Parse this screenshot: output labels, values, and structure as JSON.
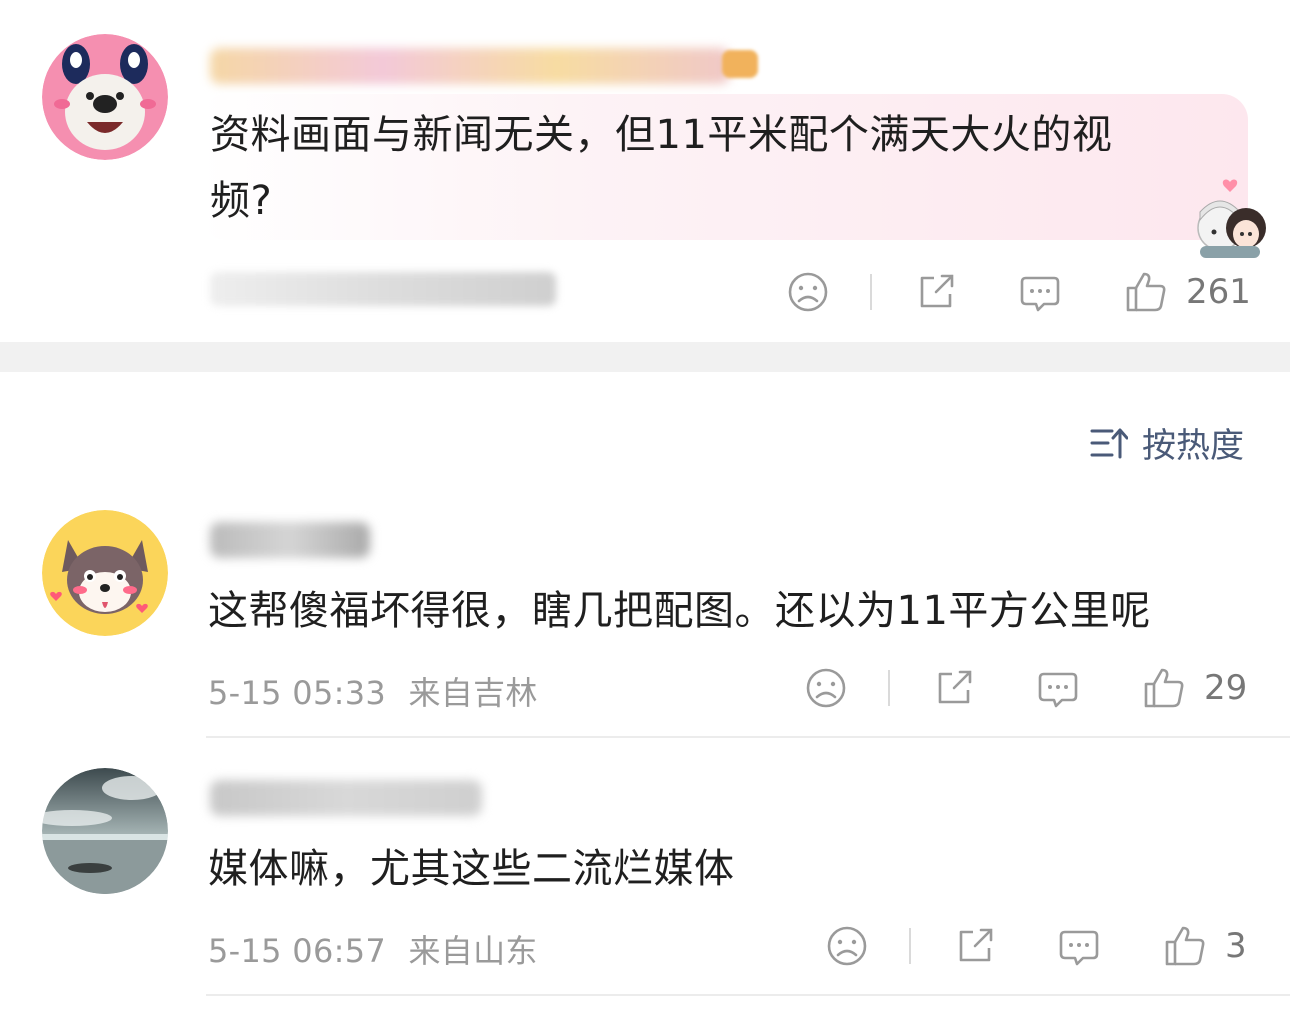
{
  "colors": {
    "accent": "#4a5a78",
    "meta": "#9a9a9a",
    "band": "#f1f1f1",
    "bubble": "#fdeef2"
  },
  "top_comment": {
    "line1": "资料画面与新闻无关，但11平米配个满天大火的视",
    "line2": "频?",
    "like_count": "261"
  },
  "sort": {
    "label": "按热度",
    "icon": "sort-icon"
  },
  "comments": [
    {
      "text": "这帮傻福坏得很，瞎几把配图。还以为11平方公里呢",
      "timestamp": "5-15 05:33",
      "location": "来自吉林",
      "like_count": "29"
    },
    {
      "text": "媒体嘛，尤其这些二流烂媒体",
      "timestamp": "5-15 06:57",
      "location": "来自山东",
      "like_count": "3"
    }
  ]
}
